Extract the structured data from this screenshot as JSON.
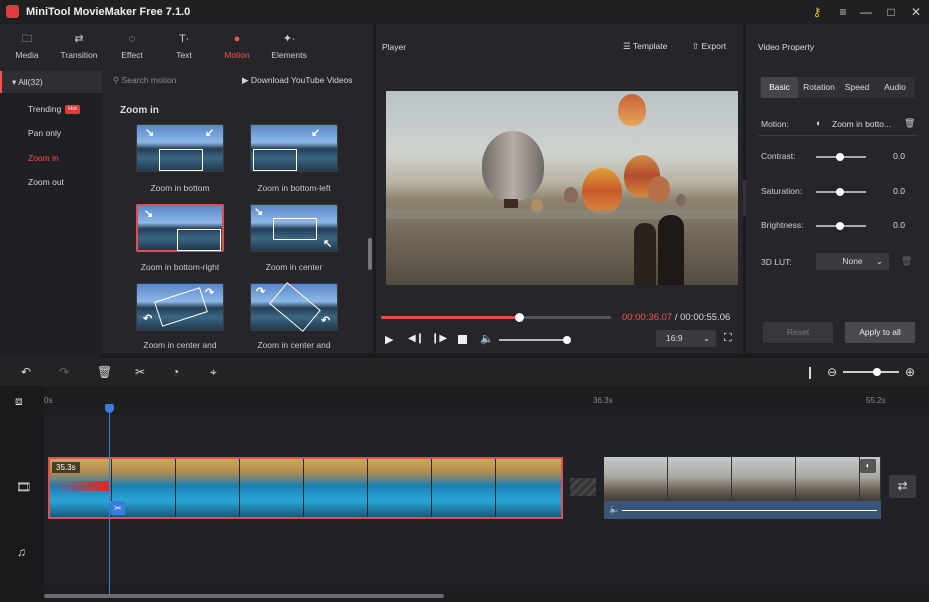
{
  "app": {
    "title": "MiniTool MovieMaker Free 7.1.0"
  },
  "toolbar": {
    "tabs": [
      {
        "label": "Media",
        "icon": "folder-icon"
      },
      {
        "label": "Transition",
        "icon": "transition-icon"
      },
      {
        "label": "Effect",
        "icon": "effect-icon"
      },
      {
        "label": "Text",
        "icon": "text-icon"
      },
      {
        "label": "Motion",
        "icon": "motion-icon",
        "active": true
      },
      {
        "label": "Elements",
        "icon": "elements-icon"
      }
    ]
  },
  "motion": {
    "all_label": "All(32)",
    "search_placeholder": "Search motion",
    "download_label": "Download YouTube Videos",
    "categories": [
      {
        "label": "Trending",
        "badge": "Hot"
      },
      {
        "label": "Pan only"
      },
      {
        "label": "Zoom in",
        "selected": true
      },
      {
        "label": "Zoom out"
      }
    ],
    "section_title": "Zoom in",
    "items": [
      {
        "label": "Zoom in bottom"
      },
      {
        "label": "Zoom in bottom-left"
      },
      {
        "label": "Zoom in bottom-right",
        "selected": true
      },
      {
        "label": "Zoom in center"
      },
      {
        "label": "Zoom in center and"
      },
      {
        "label": "Zoom in center and"
      }
    ]
  },
  "player": {
    "title": "Player",
    "template_label": "Template",
    "export_label": "Export",
    "current_time": "00:00:36.07",
    "separator": "/",
    "total_time": "00:00:55.06",
    "progress": 0.6,
    "volume": 1.0,
    "aspect": "16:9"
  },
  "properties": {
    "title": "Video Property",
    "tabs": [
      "Basic",
      "Rotation",
      "Speed",
      "Audio"
    ],
    "active_tab": "Basic",
    "motion_label": "Motion:",
    "motion_value": "Zoom in botto...",
    "contrast_label": "Contrast:",
    "contrast_value": "0.0",
    "saturation_label": "Saturation:",
    "saturation_value": "0.0",
    "brightness_label": "Brightness:",
    "brightness_value": "0.0",
    "lut_label": "3D LUT:",
    "lut_value": "None",
    "reset_label": "Reset",
    "apply_label": "Apply to all"
  },
  "timeline": {
    "ruler": [
      "0s",
      "36.3s",
      "55.2s"
    ],
    "clip1_duration": "35.3s",
    "zoom_level": 0.6
  },
  "colors": {
    "accent": "#ff4e4e",
    "playhead": "#3a7be0"
  }
}
